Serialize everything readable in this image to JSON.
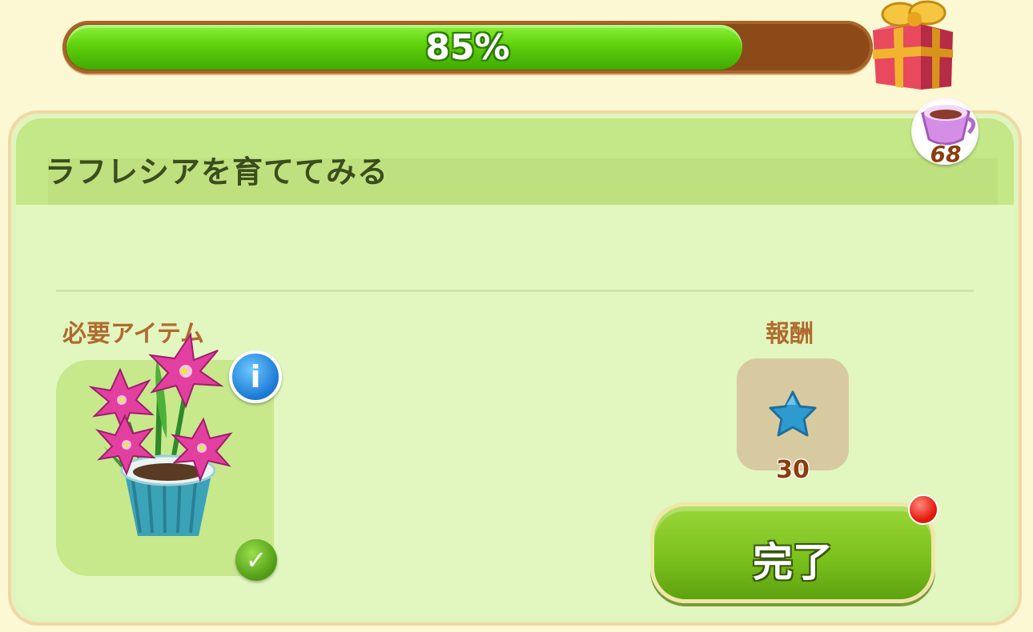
{
  "progress": {
    "value": 0.85,
    "label": "85%"
  },
  "quest": {
    "title": "ラフレシアを育ててみる"
  },
  "currency": {
    "icon": "teacup-icon",
    "count": "68"
  },
  "required": {
    "label": "必要アイテム",
    "item_icon": "lily-plant-icon"
  },
  "reward": {
    "label": "報酬",
    "icon": "blue-star-icon",
    "count": "30"
  },
  "actions": {
    "complete_label": "完了"
  },
  "colors": {
    "progress_green": "#5fd20c",
    "progress_track": "#8b4a17",
    "panel_bg": "#e2f6c0",
    "header_bg": "#c4e787"
  }
}
